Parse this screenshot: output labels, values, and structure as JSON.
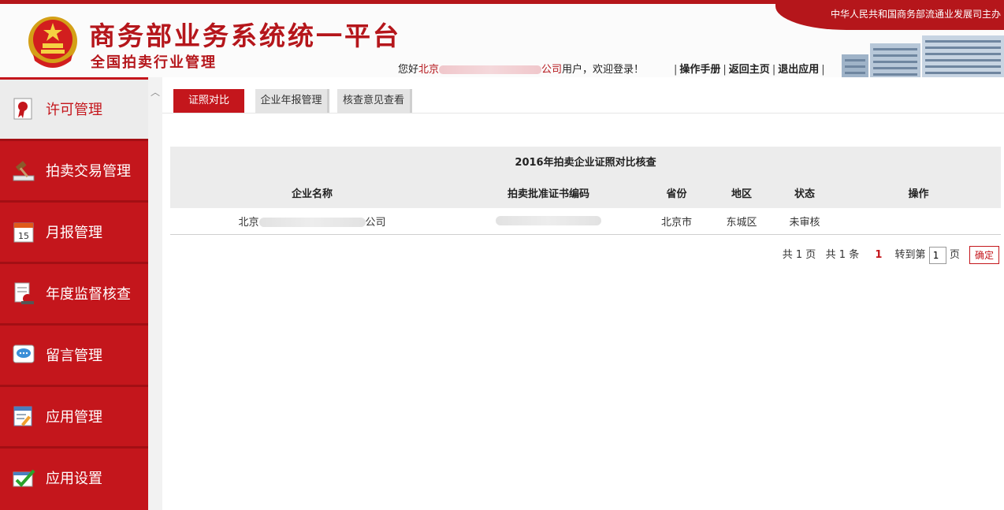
{
  "header": {
    "title": "商务部业务系统统一平台",
    "subtitle": "全国拍卖行业管理",
    "ministry": "中华人民共和国商务部流通业发展司主办",
    "welcome_prefix": "您好",
    "welcome_user_start": "北京",
    "welcome_user_end": "公司",
    "welcome_suffix": "用户，欢迎登录！",
    "links": [
      "操作手册",
      "返回主页",
      "退出应用"
    ]
  },
  "sidebar": {
    "items": [
      {
        "label": "许可管理",
        "icon": "certificate-icon",
        "active": true
      },
      {
        "label": "拍卖交易管理",
        "icon": "gavel-icon",
        "active": false
      },
      {
        "label": "月报管理",
        "icon": "calendar-icon",
        "active": false
      },
      {
        "label": "年度监督核查",
        "icon": "document-edit-icon",
        "active": false
      },
      {
        "label": "留言管理",
        "icon": "message-icon",
        "active": false
      },
      {
        "label": "应用管理",
        "icon": "app-edit-icon",
        "active": false
      },
      {
        "label": "应用设置",
        "icon": "settings-check-icon",
        "active": false
      }
    ]
  },
  "tabs": [
    "证照对比",
    "企业年报管理",
    "核查意见查看"
  ],
  "panel": {
    "title": "2016年拍卖企业证照对比核查",
    "columns": [
      "企业名称",
      "拍卖批准证书编码",
      "省份",
      "地区",
      "状态",
      "操作"
    ],
    "rows": [
      {
        "name_start": "北京",
        "name_end": "公司",
        "province": "北京市",
        "region": "东城区",
        "status": "未审核"
      }
    ]
  },
  "pager": {
    "total_pages": "共 1 页",
    "total_items": "共 1 条",
    "current": "1",
    "goto_label": "转到第",
    "page_input": "1",
    "page_unit": "页",
    "confirm": "确定"
  },
  "colors": {
    "brand_red": "#c4161c",
    "header_red": "#b5161b"
  }
}
